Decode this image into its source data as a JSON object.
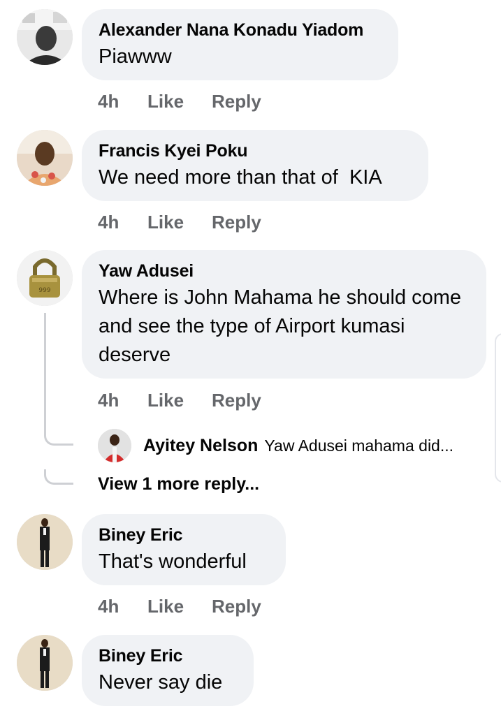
{
  "comments": [
    {
      "name": "Alexander Nana Konadu Yiadom",
      "text": "Piawww",
      "time": "4h",
      "like": "Like",
      "reply": "Reply"
    },
    {
      "name": "Francis Kyei Poku",
      "text": "We need more than that of  KIA",
      "time": "4h",
      "like": "Like",
      "reply": "Reply"
    },
    {
      "name": "Yaw Adusei",
      "text": "Where is John Mahama he should come and see the type of Airport kumasi deserve",
      "time": "4h",
      "like": "Like",
      "reply": "Reply"
    },
    {
      "name": "Biney Eric",
      "text": "That's wonderful",
      "time": "4h",
      "like": "Like",
      "reply": "Reply"
    },
    {
      "name": "Biney Eric",
      "text": "Never say die"
    }
  ],
  "reply_preview": {
    "name": "Ayitey Nelson",
    "snippet": "Yaw Adusei mahama did..."
  },
  "view_more_label": "View 1 more reply...",
  "colors": {
    "bubble": "#f0f2f5",
    "meta": "#65676b",
    "text": "#050505",
    "thread": "#ced0d4"
  }
}
